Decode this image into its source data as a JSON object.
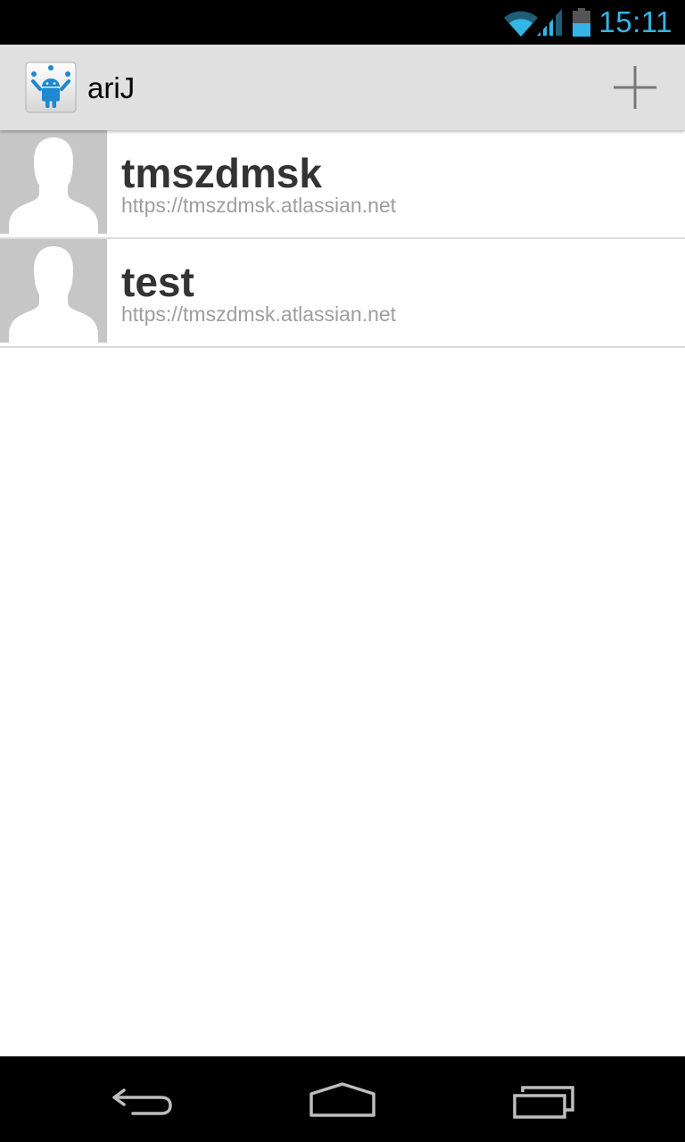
{
  "status_bar": {
    "time": "15:11",
    "icons": [
      "wifi-icon",
      "signal-icon",
      "battery-icon"
    ],
    "clock_color": "#33b5e5"
  },
  "action_bar": {
    "title": "ariJ",
    "app_icon": "android-app-icon",
    "action_icon": "plus-icon"
  },
  "accounts": [
    {
      "name": "tmszdmsk",
      "url": "https://tmszdmsk.atlassian.net",
      "avatar": "default-person-icon"
    },
    {
      "name": "test",
      "url": "https://tmszdmsk.atlassian.net",
      "avatar": "default-person-icon"
    }
  ],
  "nav_bar": {
    "buttons": [
      "back-icon",
      "home-icon",
      "recents-icon"
    ]
  },
  "colors": {
    "accent": "#33b5e5",
    "action_bar_bg": "#e0e0e0",
    "title_text": "#333333",
    "subtitle_text": "#9e9e9e"
  }
}
